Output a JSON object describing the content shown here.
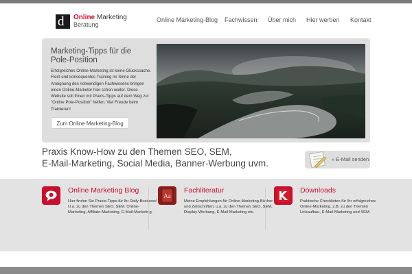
{
  "logo": {
    "mark": "d",
    "brand": "Online",
    "line1_rest": "Marketing",
    "line2": "Beratung"
  },
  "nav": {
    "items": [
      "Online Marketing-Blog",
      "Fachwissen",
      "Über mich",
      "Hier werben",
      "Kontakt"
    ]
  },
  "hero": {
    "title": "Marketing-Tipps für die Pole-Position",
    "text": "Erfolgreiches Online-Marketing ist keine Glückssache. Fleiß und konsequentes Training im Sinne der Aneignung des notwendigen Fachwissens bringen einen Online-Marketer hier schon weiter. Diese Website soll Ihnen mit Praxis-Tipps auf dem Weg zur \"Online Pole-Position\" helfen. Viel Freude beim Trainieren!",
    "button": "Zum Online Marketing-Blog"
  },
  "praxis": {
    "line1": "Praxis Know-How zu den Themen SEO, SEM,",
    "line2": "E-Mail-Marketing, Social Media, Banner-Werbung uvm."
  },
  "email_button": {
    "label": "» E-Mail senden"
  },
  "columns": [
    {
      "title": "Online Marketing Blog",
      "text": "Hier finden Sie Praxis-Tipps für Ihr Daily Business! U.a. zu den Themen SEO, SEM, Online-Marketing, Affiliate-Marketing, E-Mail-Marketing."
    },
    {
      "title": "Fachliteratur",
      "icon_text": "Aa",
      "text": "Meine Empfehlungen für Online-Marketing-Bücher und Zeitschriften; u.a. zu den Themen SEO, SEM, Display-Werbung, E-Mail-Marketing etc."
    },
    {
      "title": "Downloads",
      "text": "Praktische Checklisten für Ihr erfolgreiches Online-Marketing, z.B. zu den Themen Linkaufbau, E-Mail-Marketing und SEM."
    }
  ],
  "colors": {
    "accent": "#c8102e",
    "panel": "#dedede",
    "band": "#e3e3e3"
  },
  "icons": [
    "blog-icon",
    "book-icon",
    "download-icon",
    "email-icon"
  ]
}
